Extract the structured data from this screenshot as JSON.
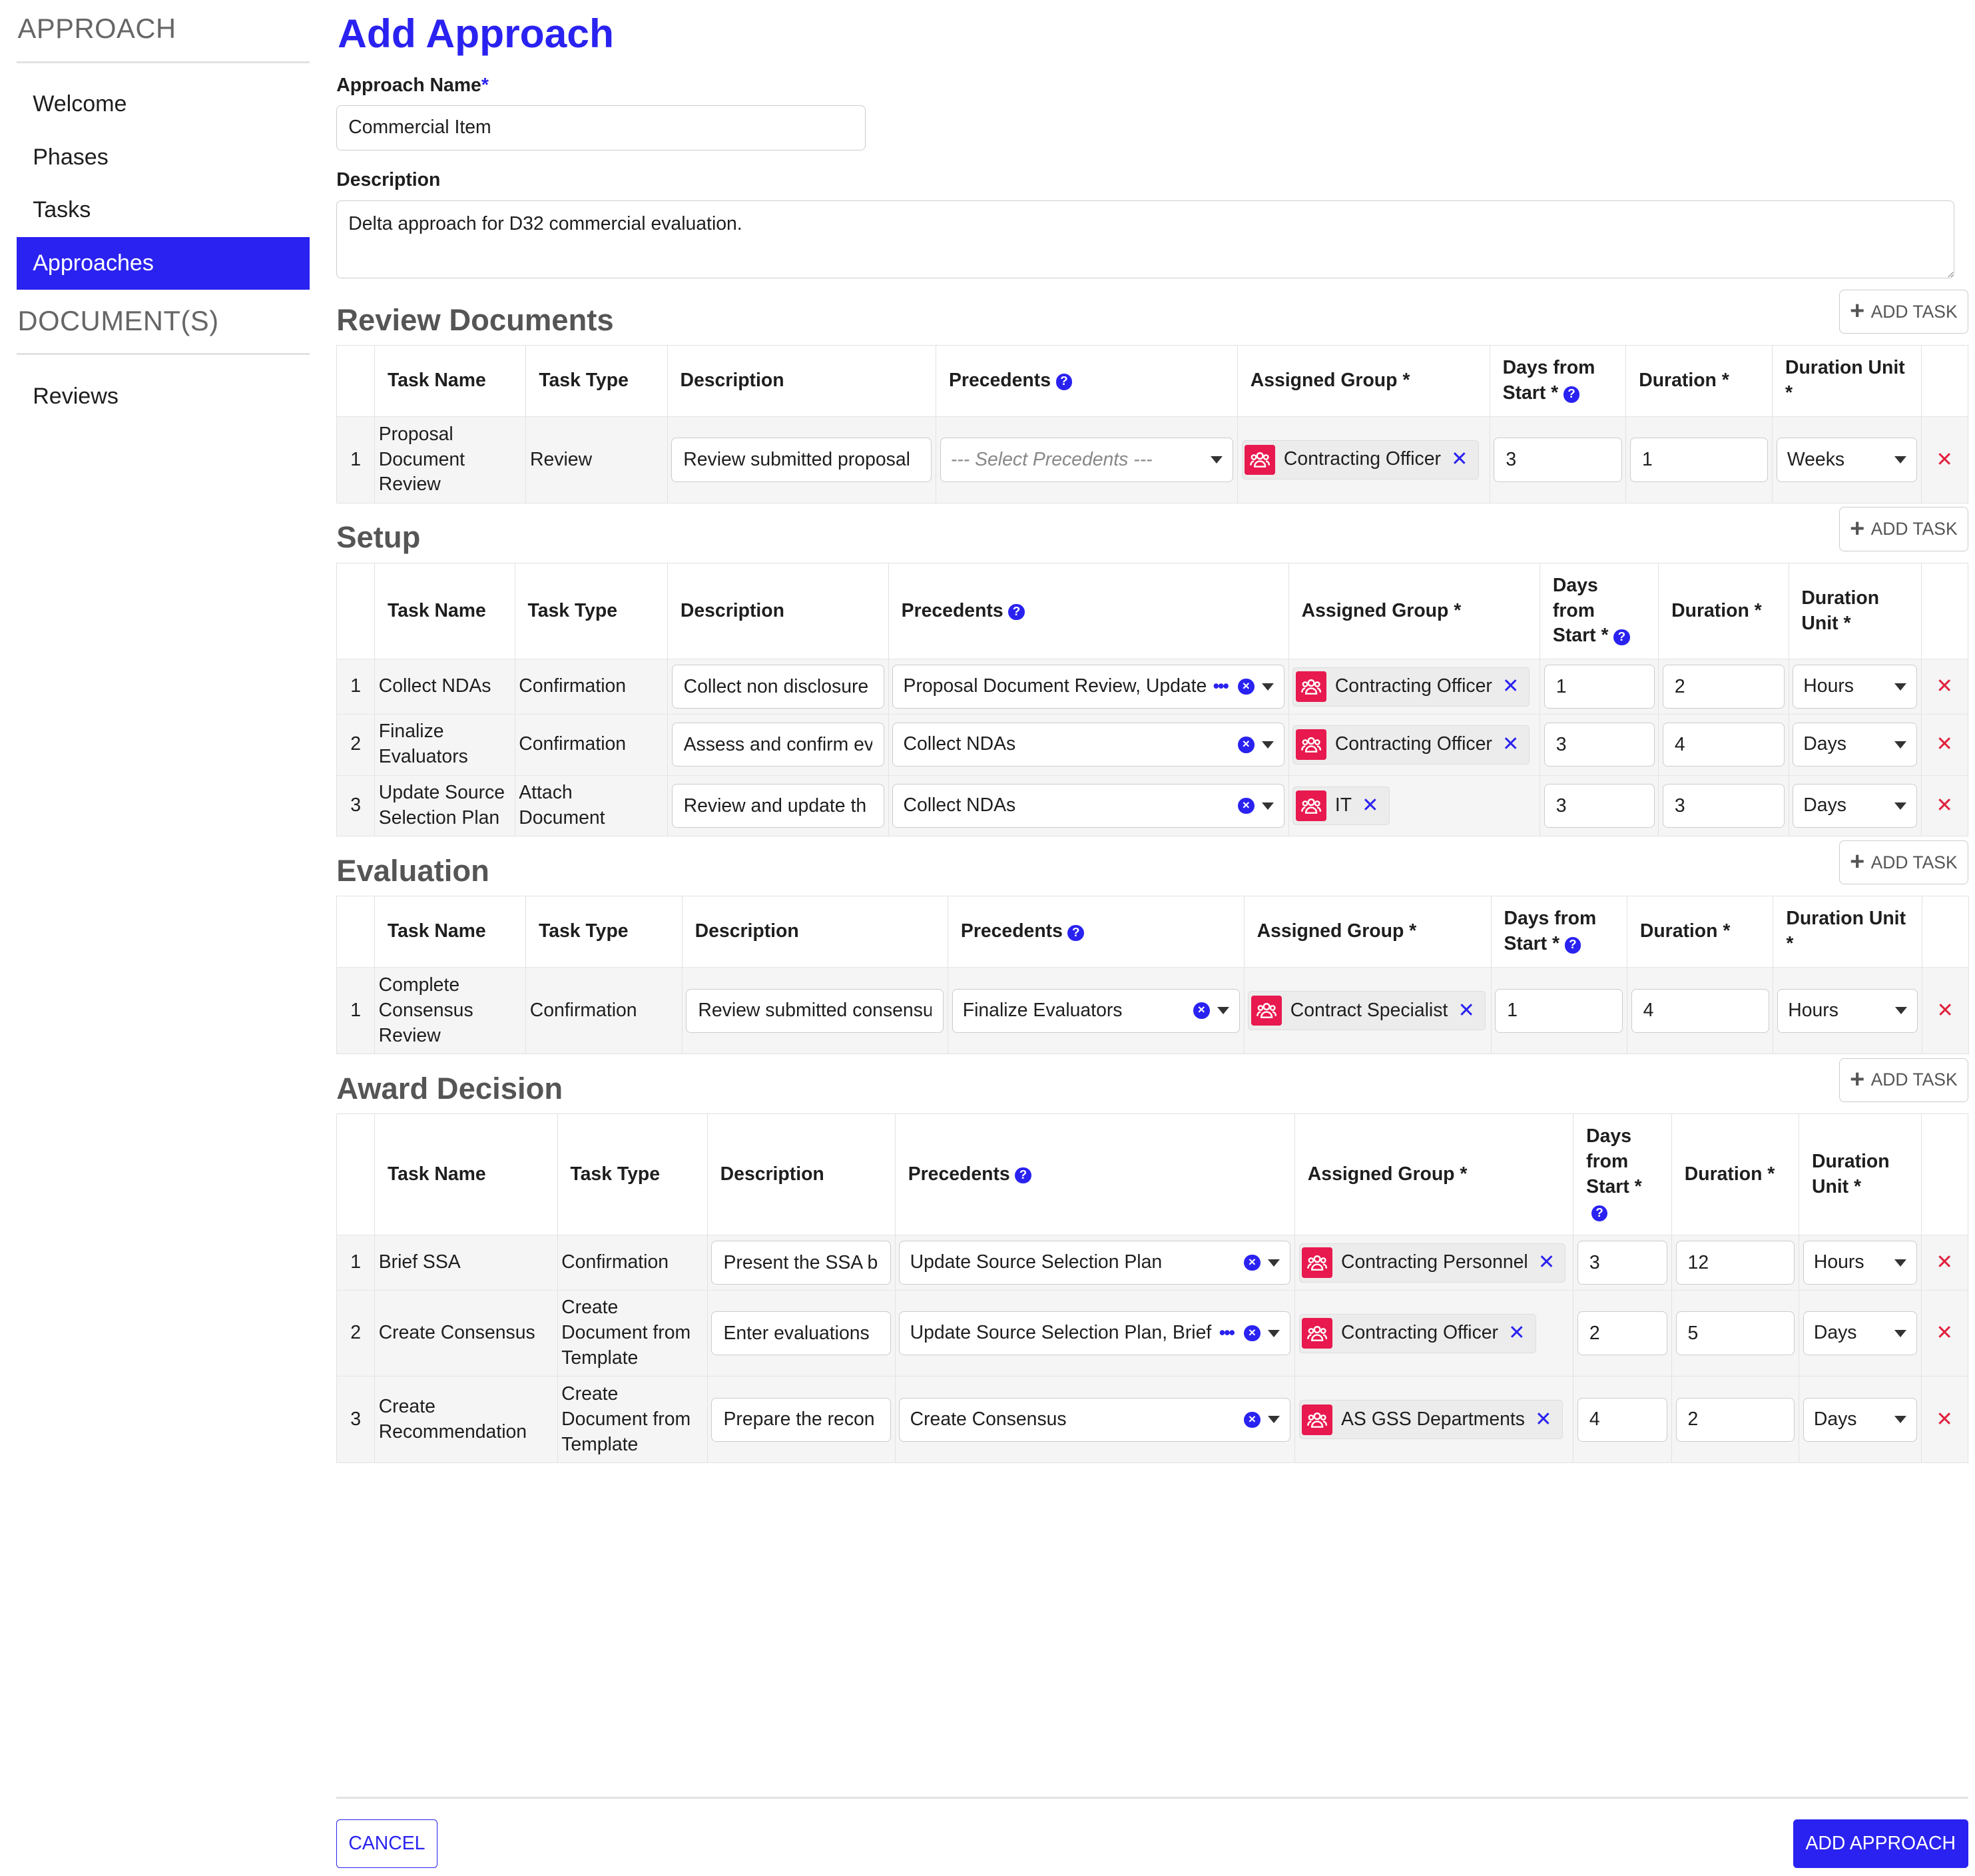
{
  "sidebar": {
    "approach_heading": "APPROACH",
    "items": [
      {
        "label": "Welcome",
        "active": false
      },
      {
        "label": "Phases",
        "active": false
      },
      {
        "label": "Tasks",
        "active": false
      },
      {
        "label": "Approaches",
        "active": true
      }
    ],
    "documents_heading": "DOCUMENT(S)",
    "doc_items": [
      {
        "label": "Reviews"
      }
    ]
  },
  "form": {
    "title": "Add Approach",
    "name_label": "Approach Name",
    "required_mark": "*",
    "name_value": "Commercial Item",
    "description_label": "Description",
    "description_value": "Delta approach for D32 commercial evaluation."
  },
  "add_task_label": "ADD TASK",
  "sections": [
    {
      "title": "Review Documents",
      "headers": [
        "Task Name",
        "Task Type",
        "Description",
        "Precedents",
        "Assigned Group *",
        "Days from Start *",
        "Duration *",
        "Duration Unit *"
      ],
      "rows": [
        {
          "num": "1",
          "name": "Proposal Document Review",
          "type": "Review",
          "description": "Review submitted proposal",
          "precedents": "--- Select Precedents ---",
          "placeholder": true,
          "more": false,
          "group": "Contracting Officer",
          "days_from_start": "3",
          "duration": "1",
          "unit": "Weeks"
        }
      ]
    },
    {
      "title": "Setup",
      "headers": [
        "Task Name",
        "Task Type",
        "Description",
        "Precedents",
        "Assigned Group *",
        "Days from Start *",
        "Duration *",
        "Duration Unit *"
      ],
      "rows": [
        {
          "num": "1",
          "name": "Collect NDAs",
          "type": "Confirmation",
          "description": "Collect non disclosure",
          "precedents": "Proposal Document Review, Update",
          "placeholder": false,
          "more": true,
          "group": "Contracting Officer",
          "days_from_start": "1",
          "duration": "2",
          "unit": "Hours"
        },
        {
          "num": "2",
          "name": "Finalize Evaluators",
          "type": "Confirmation",
          "description": "Assess and confirm ev",
          "precedents": "Collect NDAs",
          "placeholder": false,
          "more": false,
          "group": "Contracting Officer",
          "days_from_start": "3",
          "duration": "4",
          "unit": "Days"
        },
        {
          "num": "3",
          "name": "Update Source Selection Plan",
          "type": "Attach Document",
          "description": "Review and update th",
          "precedents": "Collect NDAs",
          "placeholder": false,
          "more": false,
          "group": "IT",
          "days_from_start": "3",
          "duration": "3",
          "unit": "Days"
        }
      ]
    },
    {
      "title": "Evaluation",
      "headers": [
        "Task Name",
        "Task Type",
        "Description",
        "Precedents",
        "Assigned Group *",
        "Days from Start *",
        "Duration *",
        "Duration Unit *"
      ],
      "rows": [
        {
          "num": "1",
          "name": "Complete Consensus Review",
          "type": "Confirmation",
          "description": "Review submitted consensu",
          "precedents": "Finalize Evaluators",
          "placeholder": false,
          "more": false,
          "group": "Contract Specialist",
          "days_from_start": "1",
          "duration": "4",
          "unit": "Hours"
        }
      ]
    },
    {
      "title": "Award Decision",
      "headers": [
        "Task Name",
        "Task Type",
        "Description",
        "Precedents",
        "Assigned Group *",
        "Days from Start *",
        "Duration *",
        "Duration Unit *"
      ],
      "rows": [
        {
          "num": "1",
          "name": "Brief SSA",
          "type": "Confirmation",
          "description": "Present the SSA bi",
          "precedents": "Update Source Selection Plan",
          "placeholder": false,
          "more": false,
          "group": "Contracting Personnel",
          "days_from_start": "3",
          "duration": "12",
          "unit": "Hours"
        },
        {
          "num": "2",
          "name": "Create Consensus",
          "type": "Create Document from Template",
          "description": "Enter evaluations",
          "precedents": "Update Source Selection Plan, Brief",
          "placeholder": false,
          "more": true,
          "group": "Contracting Officer",
          "days_from_start": "2",
          "duration": "5",
          "unit": "Days"
        },
        {
          "num": "3",
          "name": "Create Recommendation",
          "type": "Create Document from Template",
          "description": "Prepare the recon",
          "precedents": "Create Consensus",
          "placeholder": false,
          "more": false,
          "group": "AS GSS Departments",
          "days_from_start": "4",
          "duration": "2",
          "unit": "Days"
        }
      ]
    }
  ],
  "footer": {
    "cancel_label": "CANCEL",
    "submit_label": "ADD APPROACH"
  },
  "colors": {
    "accent": "#2a22f0",
    "group_icon": "#e8194e",
    "delete": "#e0213c"
  },
  "icons": {
    "add": "plus-icon",
    "help": "question-circle-icon",
    "clear": "clear-circle-icon",
    "more": "ellipsis-icon",
    "group": "users-icon",
    "remove_chip": "x-icon",
    "delete_row": "delete-x-icon"
  }
}
